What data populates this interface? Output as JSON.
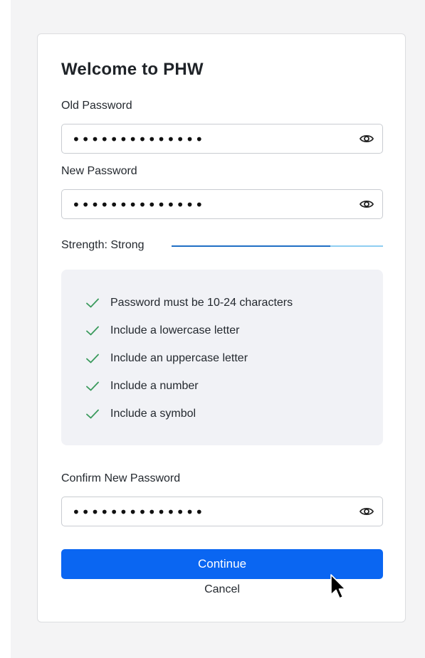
{
  "form": {
    "title": "Welcome to PHW",
    "old_password": {
      "label": "Old Password",
      "masked_value": "••••••••••••••"
    },
    "new_password": {
      "label": "New Password",
      "masked_value": "••••••••••••••"
    },
    "strength": {
      "label": "Strength: Strong",
      "level_fraction": 0.75
    },
    "rules": [
      {
        "text": "Password must be 10-24 characters",
        "met": true
      },
      {
        "text": "Include a lowercase letter",
        "met": true
      },
      {
        "text": "Include an uppercase letter",
        "met": true
      },
      {
        "text": "Include a number",
        "met": true
      },
      {
        "text": "Include a symbol",
        "met": true
      }
    ],
    "confirm_password": {
      "label": "Confirm New Password",
      "masked_value": "••••••••••••••"
    },
    "continue_label": "Continue",
    "cancel_label": "Cancel"
  },
  "icons": {
    "visibility_toggle": "eye-icon",
    "rule_met": "checkmark-icon",
    "pointer": "mouse-cursor-icon"
  },
  "colors": {
    "primary_button": "#0a66f2",
    "strength_fill": "#1f6fc5",
    "strength_track": "#8ecdf2",
    "check": "#3a9a5c",
    "rules_background": "#f1f2f6"
  }
}
